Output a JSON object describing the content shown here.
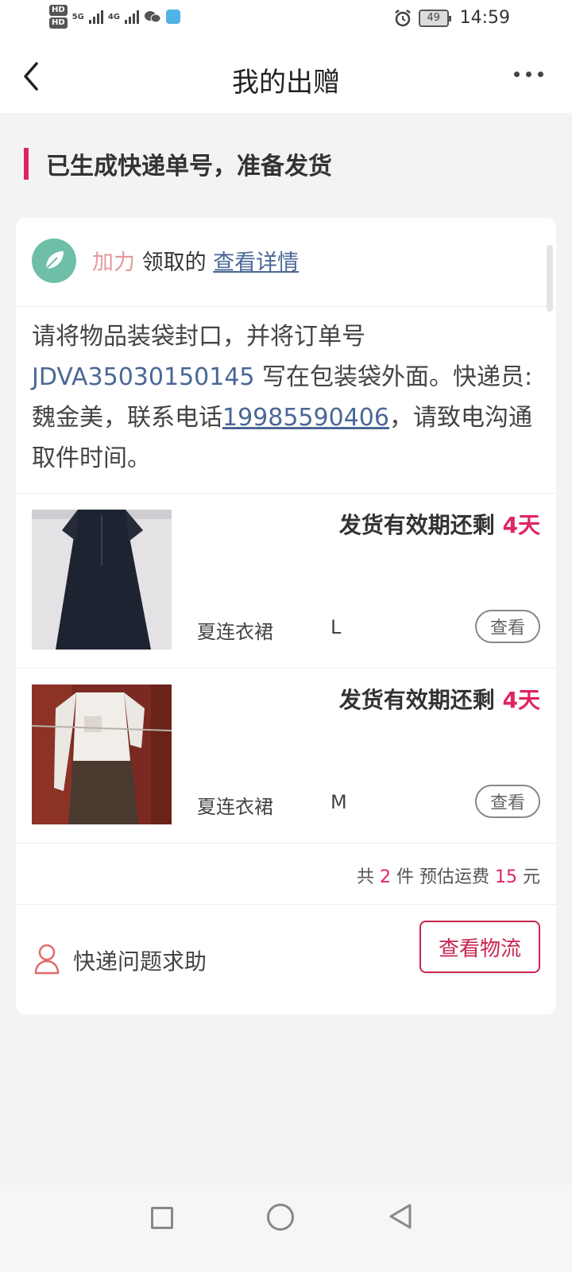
{
  "status_bar": {
    "hd_top": "HD",
    "hd_bottom": "HD",
    "signal_1_label": "5G",
    "signal_2_label": "4G",
    "battery": "49",
    "time": "14:59",
    "icons": [
      "signal-icon",
      "wechat-icon",
      "app-icon",
      "alarm-icon",
      "battery-icon"
    ]
  },
  "nav": {
    "title": "我的出赠",
    "back_icon": "chevron-left-icon",
    "more_icon": "more-icon"
  },
  "status_heading": "已生成快递单号，准备发货",
  "giver": {
    "name": "加力",
    "suffix": "领取的",
    "link": "查看详情"
  },
  "notice": {
    "before_order": "请将物品装袋封口，并将订单号 ",
    "order_no": "JDVA35030150145",
    "after_order": " 写在包装袋外面。快递员:魏金美，联系电话",
    "phone": "19985590406",
    "after_phone": "，请致电沟通取件时间。"
  },
  "items": [
    {
      "deadline_prefix": "发货有效期还剩 ",
      "deadline_days": "4天",
      "name": "夏连衣裙",
      "size": "L",
      "button": "查看"
    },
    {
      "deadline_prefix": "发货有效期还剩 ",
      "deadline_days": "4天",
      "name": "夏连衣裙",
      "size": "M",
      "button": "查看"
    }
  ],
  "summary": {
    "p1": "共 ",
    "count": "2",
    "p2": " 件 预估运费 ",
    "fee": "15",
    "p3": " 元"
  },
  "help": {
    "label": "快递问题求助",
    "button": "查看物流"
  },
  "colors": {
    "accent": "#e0245e",
    "link": "#4a6796",
    "button_border": "#c8254f"
  }
}
